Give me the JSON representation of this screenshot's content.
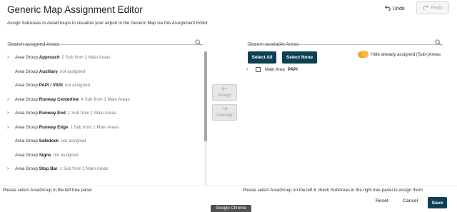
{
  "header": {
    "title": "Generic Map Assignment Editor",
    "subtitle": "Assign SubAreas to AreaGroups to visualize your airport in the Generic Map via this Assignment Editor",
    "undo_label": "Undo",
    "redo_label": "Redo"
  },
  "left": {
    "search_placeholder": "Search assigned Areas",
    "items": [
      {
        "prefix": "Area Group",
        "name": "Approach",
        "meta": "2 Sub from 2 Main Areas",
        "expandable": true
      },
      {
        "prefix": "Area Group",
        "name": "Auxiliary",
        "meta": "not assigned",
        "expandable": false
      },
      {
        "prefix": "Area Group",
        "name": "PAPI / VASI",
        "meta": "not assigned",
        "expandable": false
      },
      {
        "prefix": "Area Group",
        "name": "Runway Centerline",
        "meta": "4 Sub from 1 Main Areas",
        "expandable": true
      },
      {
        "prefix": "Area Group",
        "name": "Runway End",
        "meta": "1 Sub from 1 Main Areas",
        "expandable": true
      },
      {
        "prefix": "Area Group",
        "name": "Runway Edge",
        "meta": "1 Sub from 1 Main Areas",
        "expandable": true
      },
      {
        "prefix": "Area Group",
        "name": "Safedock",
        "meta": "not assigned",
        "expandable": false
      },
      {
        "prefix": "Area Group",
        "name": "Signs",
        "meta": "not assigned",
        "expandable": false
      },
      {
        "prefix": "Area Group",
        "name": "Stop Bar",
        "meta": "1 Sub from 1 Main Areas",
        "expandable": true
      }
    ],
    "hint": "Please select AreaGroup in the left tree panel"
  },
  "middle": {
    "assign_label": "Assign",
    "unassign_label": "Unassign"
  },
  "right": {
    "search_placeholder": "Search available Areas",
    "select_all_label": "Select All",
    "select_none_label": "Select None",
    "toggle_label": "Hide already assigned (Sub-)Areas",
    "toggle_on": true,
    "item": {
      "prefix": "Main Area",
      "name": "PAPI"
    },
    "hint": "Please select AreaGroup on the left & check SubAreas in the right tree panel to assign them"
  },
  "footer": {
    "reset_label": "Reset",
    "cancel_label": "Cancel",
    "save_label": "Save",
    "browser_tag": "Google Chrome"
  },
  "colors": {
    "primary": "#0e4054",
    "toggle": "#f5a623"
  }
}
